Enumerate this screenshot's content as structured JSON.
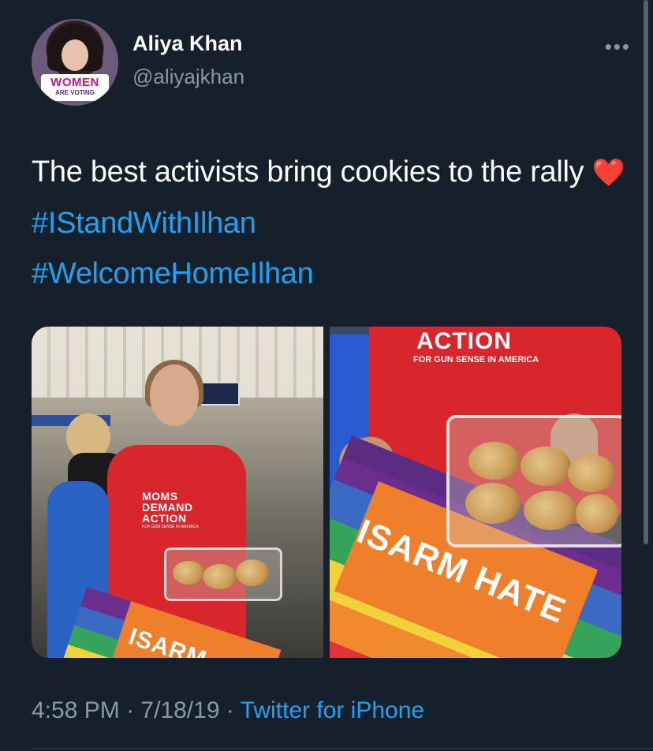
{
  "user": {
    "display_name": "Aliya Khan",
    "handle": "@aliyajkhan",
    "avatar_badge_line1": "WOMEN",
    "avatar_badge_line2": "ARE VOTING"
  },
  "more_icon": "more-horizontal-icon",
  "tweet": {
    "text_before": "The best activists bring cookies to the rally",
    "emoji": "❤️",
    "hashtags": [
      "#IStandWithIlhan",
      "#WelcomeHomeIlhan"
    ]
  },
  "media": {
    "left_photo": {
      "shirt_lines": [
        "MOMS",
        "DEMAND",
        "ACTION"
      ],
      "shirt_small": "FOR GUN SENSE IN AMERICA",
      "sign_text": "ISARM"
    },
    "right_photo": {
      "shirt_title": "ACTION",
      "shirt_sub": "FOR GUN SENSE IN AMERICA",
      "sign_text": "ISARM HATE"
    }
  },
  "footer": {
    "time": "4:58 PM",
    "date": "7/18/19",
    "separator": "·",
    "source": "Twitter for iPhone"
  },
  "colors": {
    "background": "#15202b",
    "link": "#1da1f2",
    "muted": "#8899a6",
    "heart": "#e0245e"
  }
}
